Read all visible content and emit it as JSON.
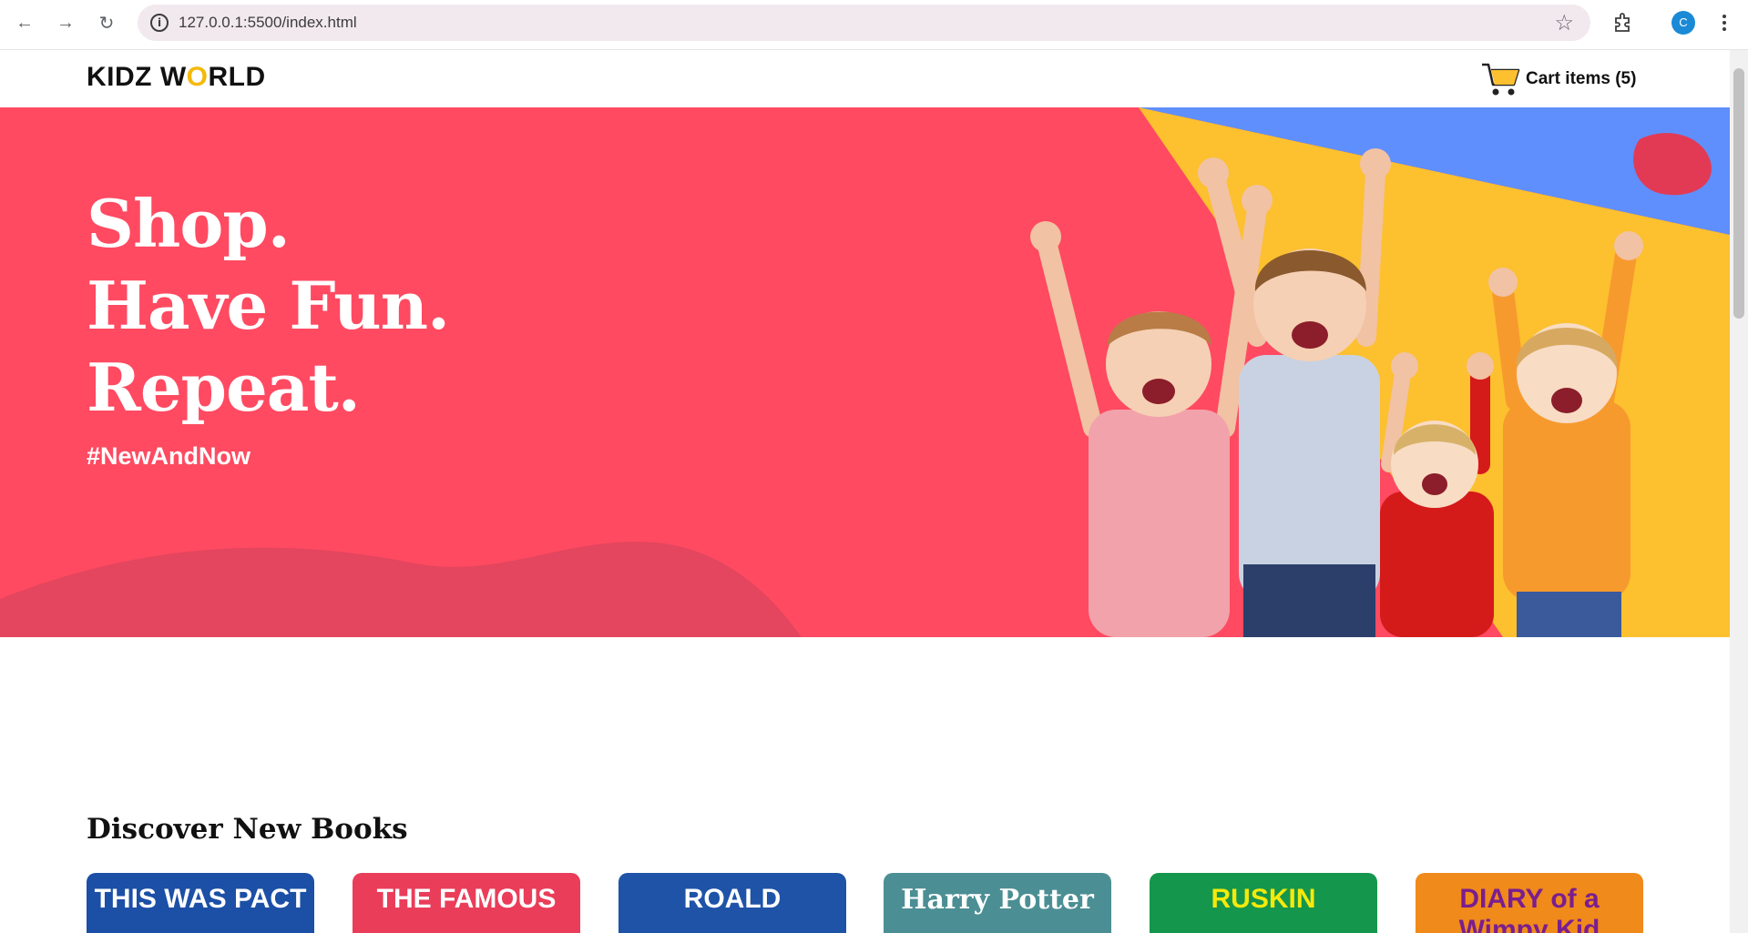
{
  "browser": {
    "url": "127.0.0.1:5500/index.html",
    "avatar_letter": "C"
  },
  "header": {
    "logo_prefix": "KIDZ W",
    "logo_o": "O",
    "logo_suffix": "RLD",
    "cart_label": "Cart items (5)"
  },
  "hero": {
    "line1": "Shop.",
    "line2": "Have Fun.",
    "line3": "Repeat.",
    "hashtag": "#NewAndNow"
  },
  "books_section": {
    "title": "Discover New Books",
    "books": [
      {
        "cover_text": "THIS WAS PACT",
        "color": "#1c4fa6"
      },
      {
        "cover_text": "THE FAMOUS",
        "color": "#ea3d5a"
      },
      {
        "cover_text": "ROALD",
        "color": "#1e53a8"
      },
      {
        "cover_text": "Harry Potter",
        "color": "#4b8f94"
      },
      {
        "cover_text": "RUSKIN",
        "color": "#14964c"
      },
      {
        "cover_text": "DIARY of a Wimpy Kid",
        "color": "#f08a1a"
      }
    ]
  },
  "colors": {
    "hero_bg": "#ff4a61",
    "accent_yellow": "#fdc02f",
    "accent_blue": "#5f8ffc"
  }
}
